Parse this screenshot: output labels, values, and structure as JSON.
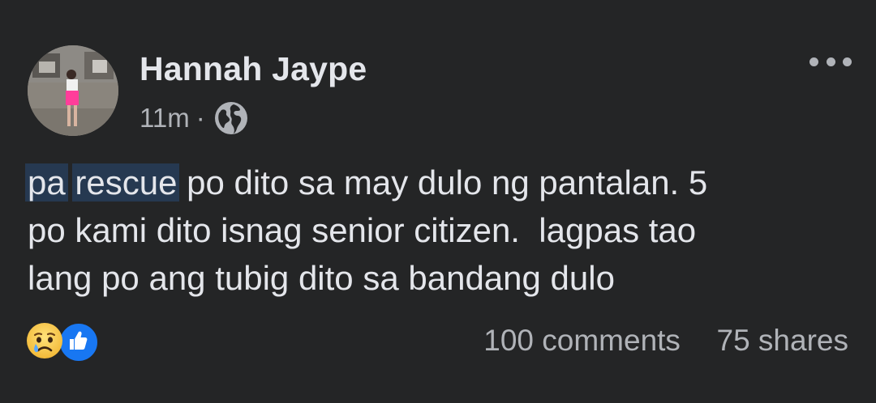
{
  "post": {
    "author": "Hannah Jaype",
    "time": "11m",
    "separator": "·",
    "privacy_icon": "globe-icon",
    "more_icon": "more-options-icon",
    "text_lines": [
      {
        "highlight_1": "pa",
        "space_1": " ",
        "highlight_2": "rescue",
        "rest": " po dito sa may dulo ng pantalan. 5"
      },
      "po kami dito isnag senior citizen.  lagpas tao",
      "lang po ang tubig dito sa bandang dulo"
    ],
    "reactions": [
      "sad-reaction-icon",
      "like-reaction-icon"
    ],
    "comments": "100 comments",
    "shares": "75 shares"
  },
  "colors": {
    "background": "#242526",
    "primary_text": "#e4e6eb",
    "secondary_text": "#b0b3b8",
    "highlight": "#263951",
    "like_blue": "#1877f2",
    "sad_yellow": "#f7c94b"
  }
}
